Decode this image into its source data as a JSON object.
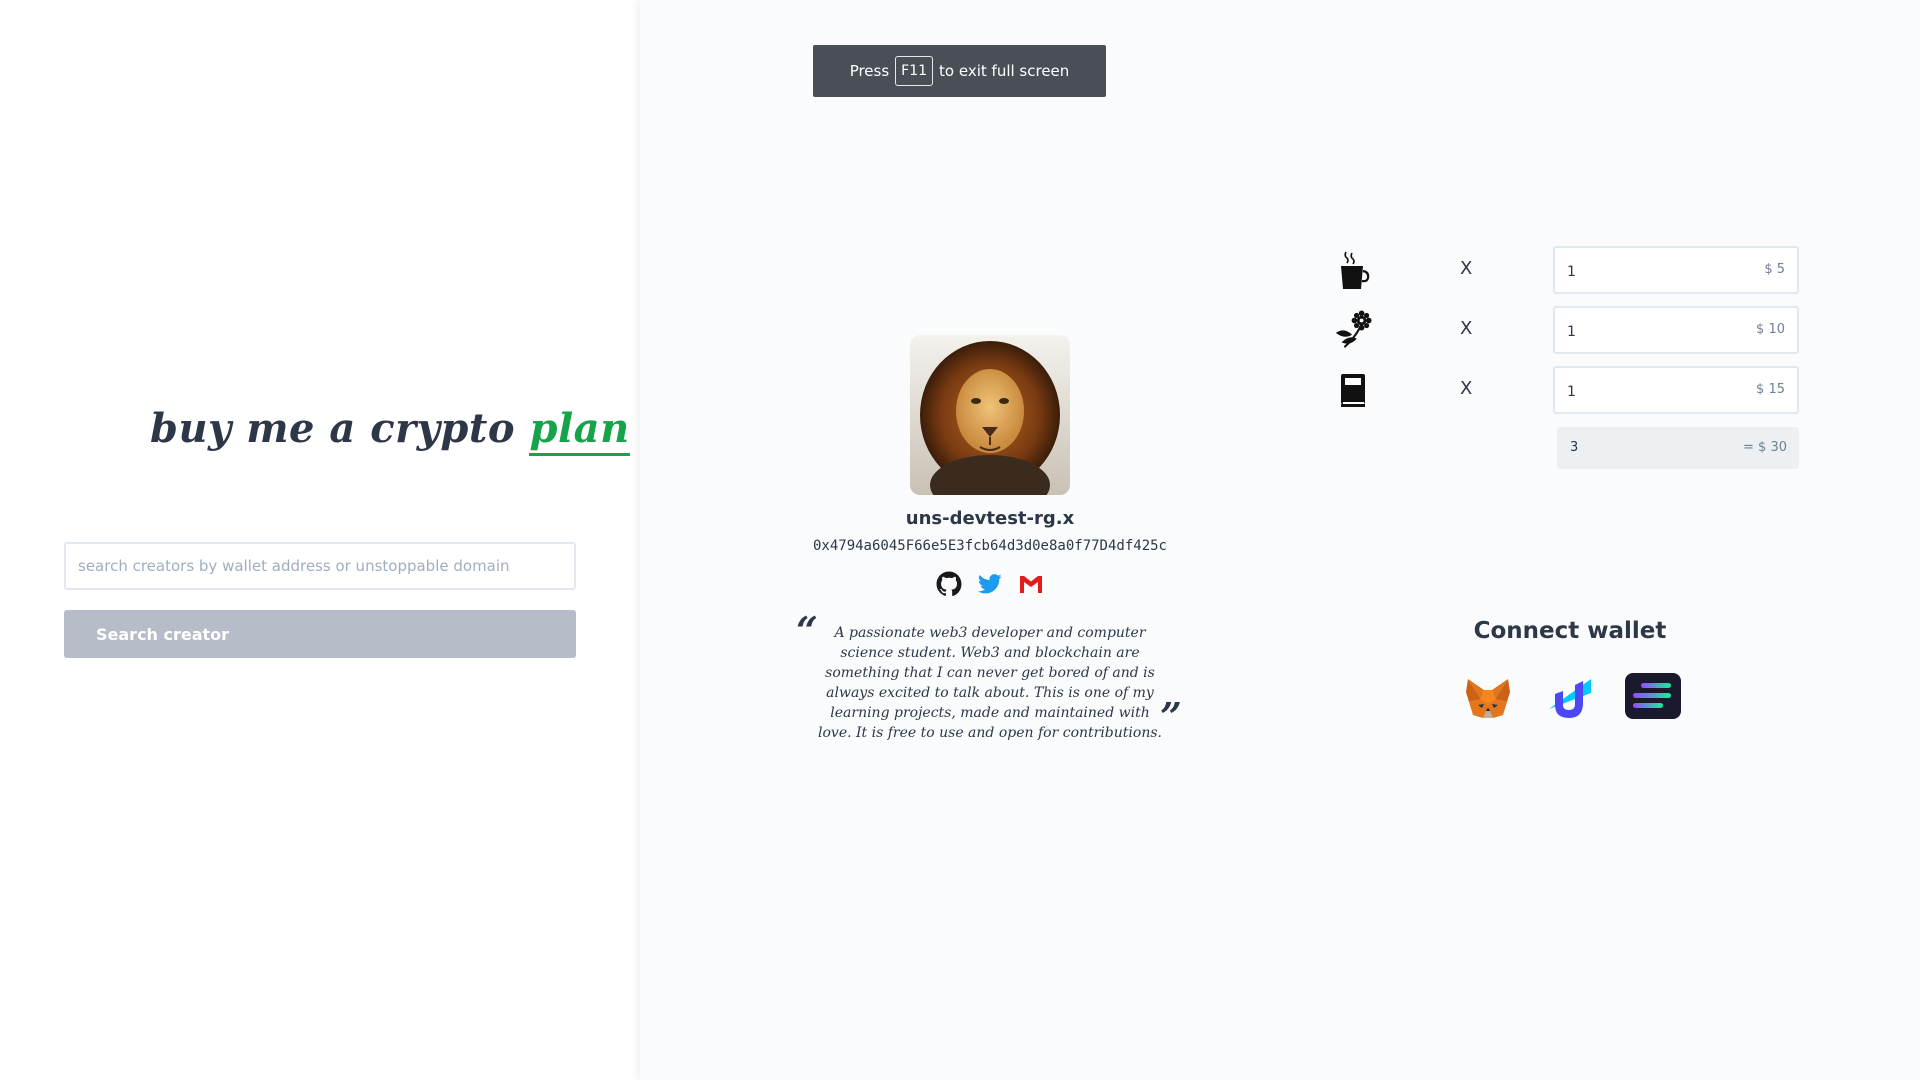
{
  "search": {
    "logo_main": "buy me a crypto ",
    "logo_accent": "plan",
    "placeholder": "search creators by wallet address or unstoppable domain",
    "button_label": "Search creator"
  },
  "fullscreen_toast": {
    "before": "Press",
    "key": "F11",
    "after": "to exit full screen"
  },
  "creator": {
    "name": "uns-devtest-rg.x",
    "address": "0x4794a6045F66e5E3fcb64d3d0e8a0f77D4df425c",
    "bio": "A passionate web3 developer and computer science student. Web3 and blockchain are something that I can never get bored of and is always excited to talk about. This is one of my learning projects, made and maintained with love. It is free to use and open for contributions.",
    "socials": [
      {
        "icon": "github-icon"
      },
      {
        "icon": "twitter-icon"
      },
      {
        "icon": "gmail-icon"
      }
    ]
  },
  "products": [
    {
      "icon": "coffee-icon",
      "times": "X",
      "quantity": "1",
      "price": "$ 5"
    },
    {
      "icon": "plant-icon",
      "times": "X",
      "quantity": "1",
      "price": "$ 10"
    },
    {
      "icon": "book-icon",
      "times": "X",
      "quantity": "1",
      "price": "$ 15"
    }
  ],
  "total": {
    "quantity": "3",
    "price": "= $ 30"
  },
  "connect": {
    "title": "Connect wallet",
    "wallets": [
      "metamask-icon",
      "unstoppable-domains-icon",
      "solana-icon"
    ]
  },
  "colors": {
    "accent": "#16a34a",
    "text": "#2d3748",
    "button_disabled": "#b6bcc8"
  }
}
